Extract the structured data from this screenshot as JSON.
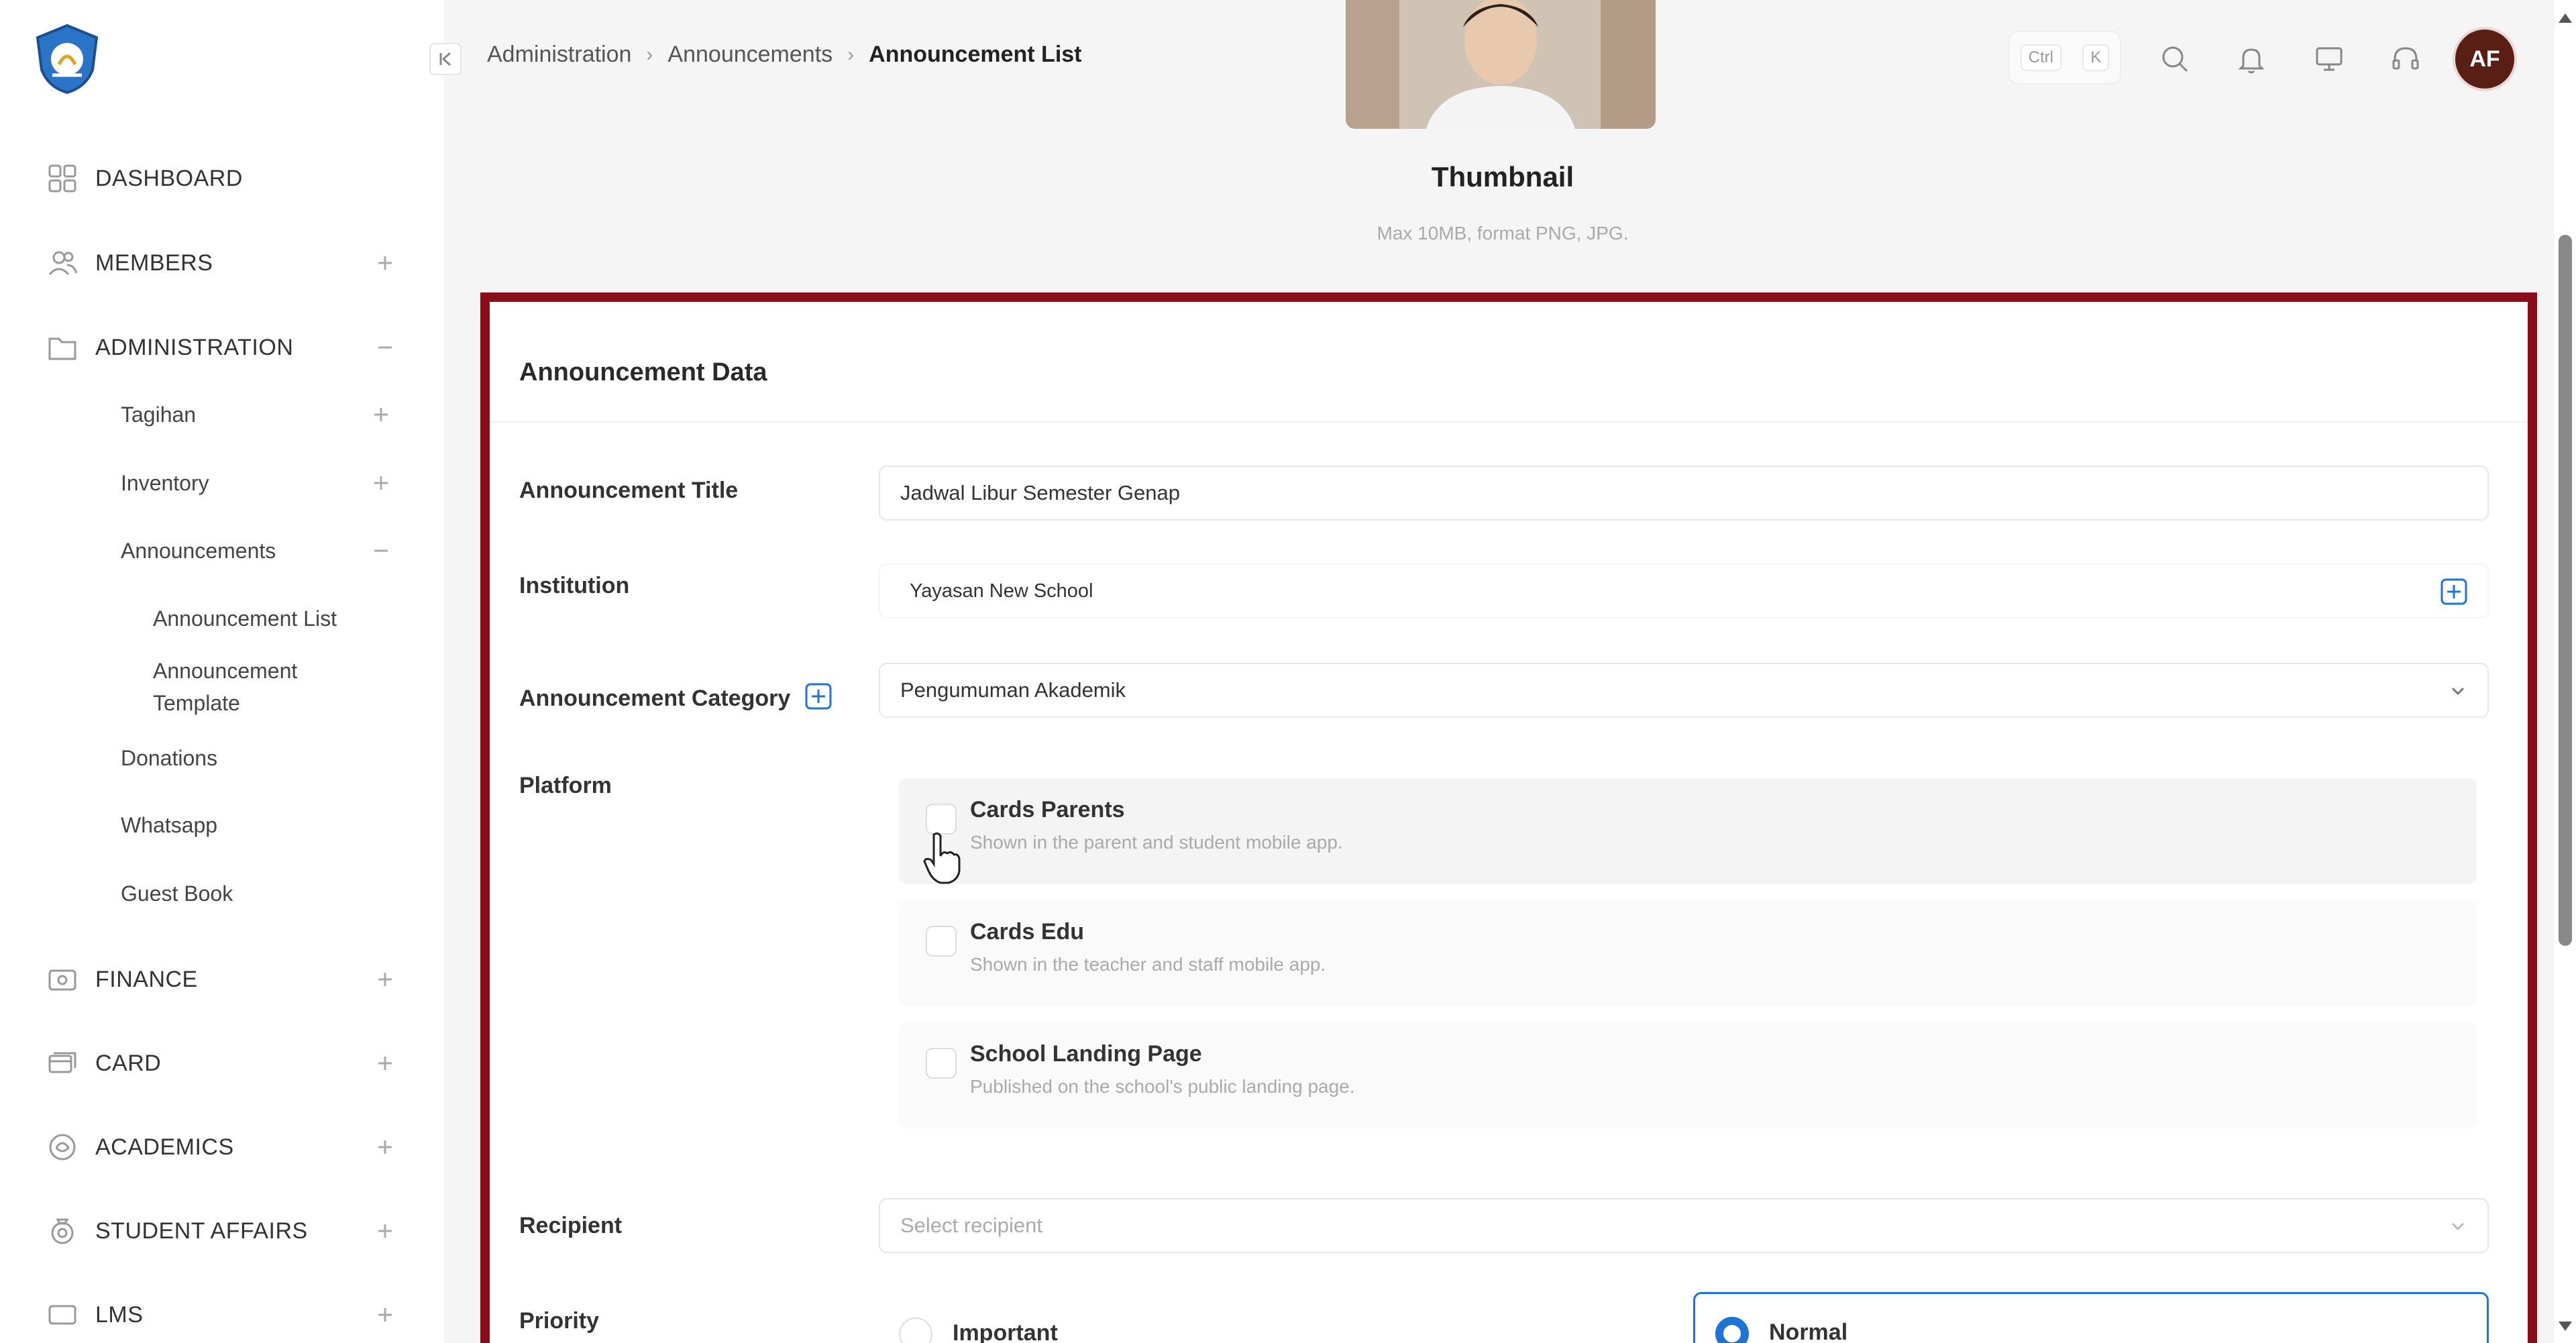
{
  "sidebar": {
    "nav": [
      {
        "label": "DASHBOARD",
        "icon": "grid-icon",
        "toggle": ""
      },
      {
        "label": "MEMBERS",
        "icon": "users-icon",
        "toggle": "+"
      },
      {
        "label": "ADMINISTRATION",
        "icon": "folder-icon",
        "toggle": "−"
      }
    ],
    "admin_sub": [
      {
        "label": "Tagihan",
        "toggle": "+"
      },
      {
        "label": "Inventory",
        "toggle": "+"
      },
      {
        "label": "Announcements",
        "toggle": "−"
      }
    ],
    "announcement_sub": [
      "Announcement List",
      "Announcement Template"
    ],
    "admin_more": [
      "Donations",
      "Whatsapp",
      "Guest Book"
    ],
    "nav_bottom": [
      {
        "label": "FINANCE",
        "icon": "wallet-icon"
      },
      {
        "label": "CARD",
        "icon": "card-icon"
      },
      {
        "label": "ACADEMICS",
        "icon": "academic-icon"
      },
      {
        "label": "STUDENT AFFAIRS",
        "icon": "student-icon"
      },
      {
        "label": "LMS",
        "icon": "lms-icon"
      }
    ]
  },
  "breadcrumb": [
    "Administration",
    "Announcements",
    "Announcement List"
  ],
  "shortcut": {
    "key1": "Ctrl",
    "key2": "K"
  },
  "user": {
    "initials": "AF"
  },
  "thumbnail": {
    "title": "Thumbnail",
    "hint": "Max 10MB, format PNG, JPG."
  },
  "form": {
    "section_title": "Announcement Data",
    "title_label": "Announcement Title",
    "title_value": "Jadwal Libur Semester Genap",
    "institution_label": "Institution",
    "institution_value": "Yayasan New School",
    "category_label": "Announcement Category",
    "category_value": "Pengumuman Akademik",
    "platform_label": "Platform",
    "platforms": [
      {
        "title": "Cards Parents",
        "desc": "Shown in the parent and student mobile app."
      },
      {
        "title": "Cards Edu",
        "desc": "Shown in the teacher and staff mobile app."
      },
      {
        "title": "School Landing Page",
        "desc": "Published on the school's public landing page."
      }
    ],
    "recipient_label": "Recipient",
    "recipient_placeholder": "Select recipient",
    "priority_label": "Priority",
    "priority_options": [
      "Important",
      "Normal"
    ],
    "priority_selected": "Normal"
  },
  "colors": {
    "accent": "#1e73d8",
    "highlight_border": "#8b0d1a",
    "avatar": "#5a1f14"
  }
}
